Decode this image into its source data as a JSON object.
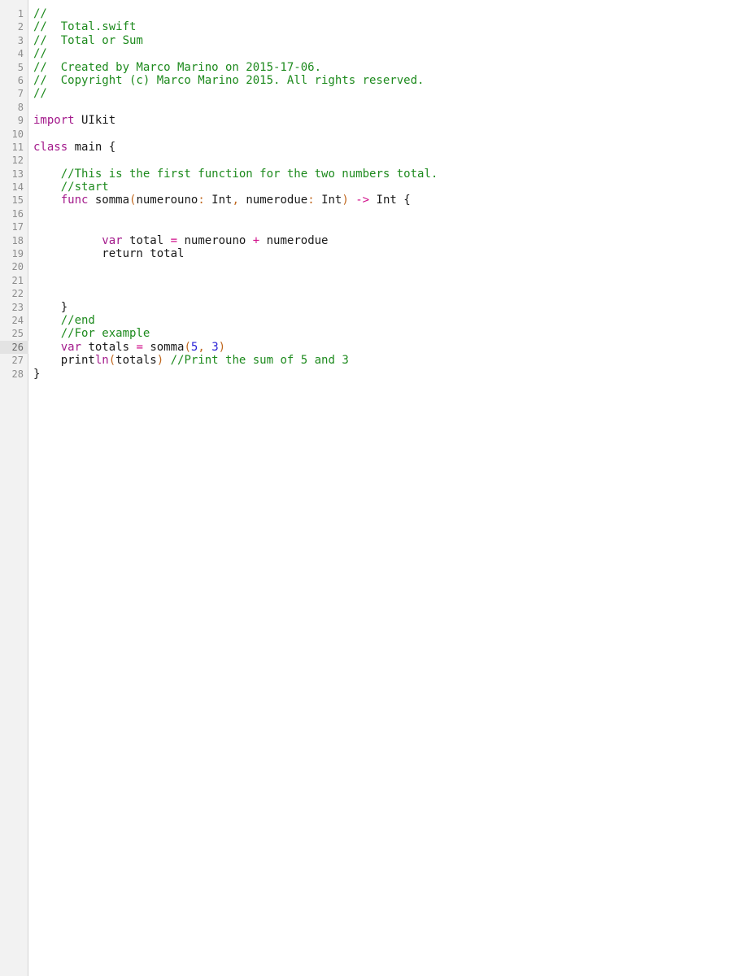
{
  "editor": {
    "current_line": 26,
    "colors": {
      "comment": "#1d8a1d",
      "keyword": "#a3198b",
      "number": "#2a22d6",
      "operator": "#d10f8a",
      "paren": "#c0671e",
      "plain": "#1a1a1a",
      "gutter_bg": "#f2f2f2"
    },
    "lines": [
      {
        "number": "1",
        "tokens": [
          {
            "t": "comment",
            "v": "//"
          }
        ]
      },
      {
        "number": "2",
        "tokens": [
          {
            "t": "comment",
            "v": "//  Total.swift"
          }
        ]
      },
      {
        "number": "3",
        "tokens": [
          {
            "t": "comment",
            "v": "//  Total or Sum"
          }
        ]
      },
      {
        "number": "4",
        "tokens": [
          {
            "t": "comment",
            "v": "//"
          }
        ]
      },
      {
        "number": "5",
        "tokens": [
          {
            "t": "comment",
            "v": "//  Created by Marco Marino on 2015-17-06."
          }
        ]
      },
      {
        "number": "6",
        "tokens": [
          {
            "t": "comment",
            "v": "//  Copyright (c) Marco Marino 2015. All rights reserved."
          }
        ]
      },
      {
        "number": "7",
        "tokens": [
          {
            "t": "comment",
            "v": "//"
          }
        ]
      },
      {
        "number": "8",
        "tokens": []
      },
      {
        "number": "9",
        "tokens": [
          {
            "t": "keyword",
            "v": "import"
          },
          {
            "t": "plain",
            "v": " UIkit"
          }
        ]
      },
      {
        "number": "10",
        "tokens": []
      },
      {
        "number": "11",
        "tokens": [
          {
            "t": "keyword",
            "v": "class"
          },
          {
            "t": "plain",
            "v": " main {"
          }
        ]
      },
      {
        "number": "12",
        "tokens": []
      },
      {
        "number": "13",
        "tokens": [
          {
            "t": "plain",
            "v": "    "
          },
          {
            "t": "comment",
            "v": "//This is the first function for the two numbers total."
          }
        ]
      },
      {
        "number": "14",
        "tokens": [
          {
            "t": "plain",
            "v": "    "
          },
          {
            "t": "comment",
            "v": "//start"
          }
        ]
      },
      {
        "number": "15",
        "tokens": [
          {
            "t": "plain",
            "v": "    "
          },
          {
            "t": "keyword",
            "v": "func"
          },
          {
            "t": "plain",
            "v": " somma"
          },
          {
            "t": "paren",
            "v": "("
          },
          {
            "t": "plain",
            "v": "numerouno"
          },
          {
            "t": "paren",
            "v": ":"
          },
          {
            "t": "plain",
            "v": " Int"
          },
          {
            "t": "paren",
            "v": ","
          },
          {
            "t": "plain",
            "v": " numerodue"
          },
          {
            "t": "paren",
            "v": ":"
          },
          {
            "t": "plain",
            "v": " Int"
          },
          {
            "t": "paren",
            "v": ")"
          },
          {
            "t": "plain",
            "v": " "
          },
          {
            "t": "operator",
            "v": "->"
          },
          {
            "t": "plain",
            "v": " Int {"
          }
        ]
      },
      {
        "number": "16",
        "tokens": []
      },
      {
        "number": "17",
        "tokens": []
      },
      {
        "number": "18",
        "tokens": [
          {
            "t": "plain",
            "v": "          "
          },
          {
            "t": "keyword",
            "v": "var"
          },
          {
            "t": "plain",
            "v": " total "
          },
          {
            "t": "operator",
            "v": "="
          },
          {
            "t": "plain",
            "v": " numerouno "
          },
          {
            "t": "operator",
            "v": "+"
          },
          {
            "t": "plain",
            "v": " numerodue"
          }
        ]
      },
      {
        "number": "19",
        "tokens": [
          {
            "t": "plain",
            "v": "          return total"
          }
        ]
      },
      {
        "number": "20",
        "tokens": []
      },
      {
        "number": "21",
        "tokens": []
      },
      {
        "number": "22",
        "tokens": []
      },
      {
        "number": "23",
        "tokens": [
          {
            "t": "plain",
            "v": "    }"
          }
        ]
      },
      {
        "number": "24",
        "tokens": [
          {
            "t": "plain",
            "v": "    "
          },
          {
            "t": "comment",
            "v": "//end"
          }
        ]
      },
      {
        "number": "25",
        "tokens": [
          {
            "t": "plain",
            "v": "    "
          },
          {
            "t": "comment",
            "v": "//For example"
          }
        ]
      },
      {
        "number": "26",
        "tokens": [
          {
            "t": "plain",
            "v": "    "
          },
          {
            "t": "keyword",
            "v": "var"
          },
          {
            "t": "plain",
            "v": " totals "
          },
          {
            "t": "operator",
            "v": "="
          },
          {
            "t": "plain",
            "v": " somma"
          },
          {
            "t": "paren",
            "v": "("
          },
          {
            "t": "number",
            "v": "5"
          },
          {
            "t": "paren",
            "v": ","
          },
          {
            "t": "plain",
            "v": " "
          },
          {
            "t": "number",
            "v": "3"
          },
          {
            "t": "paren",
            "v": ")"
          }
        ]
      },
      {
        "number": "27",
        "tokens": [
          {
            "t": "plain",
            "v": "    print"
          },
          {
            "t": "keyword",
            "v": "ln"
          },
          {
            "t": "paren",
            "v": "("
          },
          {
            "t": "plain",
            "v": "totals"
          },
          {
            "t": "paren",
            "v": ")"
          },
          {
            "t": "plain",
            "v": " "
          },
          {
            "t": "comment",
            "v": "//Print the sum of 5 and 3"
          }
        ]
      },
      {
        "number": "28",
        "tokens": [
          {
            "t": "plain",
            "v": "}"
          }
        ]
      }
    ]
  }
}
